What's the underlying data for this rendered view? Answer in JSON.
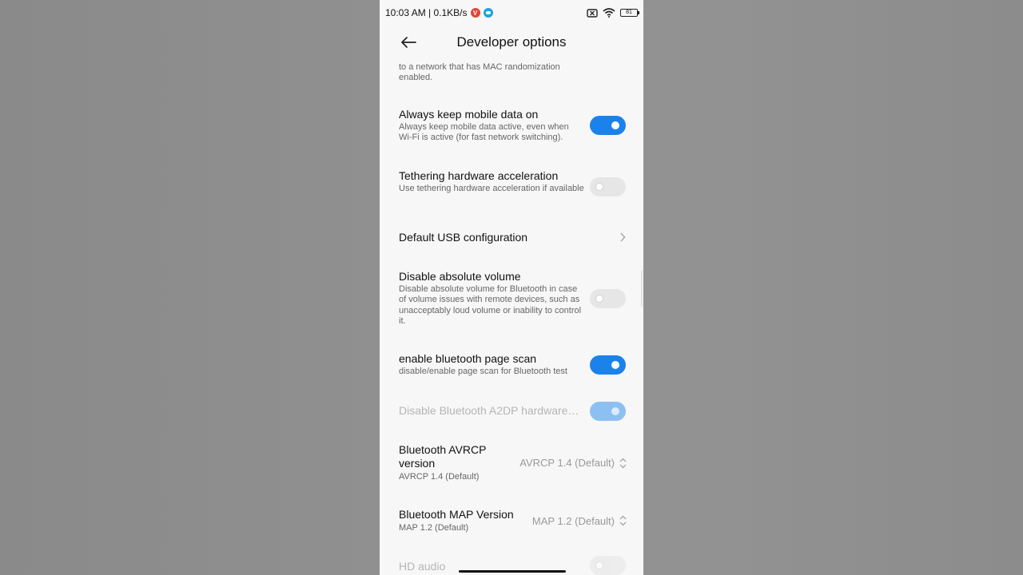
{
  "status_bar": {
    "time_speed": "10:03 AM | 0.1KB/s",
    "notif_v": "V",
    "battery": "81"
  },
  "header": {
    "title": "Developer options"
  },
  "items": [
    {
      "desc": "to a network that has MAC randomization enabled."
    },
    {
      "title": "Always keep mobile data on",
      "desc": "Always keep mobile data active, even when Wi-Fi is active (for fast network switching).",
      "state": "on"
    },
    {
      "title": "Tethering hardware acceleration",
      "desc": "Use tethering hardware acceleration if available",
      "state": "off"
    },
    {
      "title": "Default USB configuration"
    },
    {
      "title": "Disable absolute volume",
      "desc": "Disable absolute volume for Bluetooth in case of volume issues with remote devices, such as unacceptably loud volume or inability to control it.",
      "state": "off"
    },
    {
      "title": "enable bluetooth page scan",
      "desc": "disable/enable page scan for Bluetooth test",
      "state": "on"
    },
    {
      "title": "Disable Bluetooth A2DP hardware…",
      "state": "on",
      "disabled": true
    },
    {
      "title": "Bluetooth AVRCP version",
      "desc": "AVRCP 1.4 (Default)",
      "value": "AVRCP 1.4 (Default)"
    },
    {
      "title": "Bluetooth MAP Version",
      "desc": "MAP 1.2 (Default)",
      "value": "MAP 1.2 (Default)"
    },
    {
      "title": "HD audio",
      "state": "off",
      "disabled": true
    }
  ],
  "colors": {
    "accent": "#1a82ea",
    "toggle_off": "#e6e6e6",
    "bg": "#f7f7f7"
  }
}
